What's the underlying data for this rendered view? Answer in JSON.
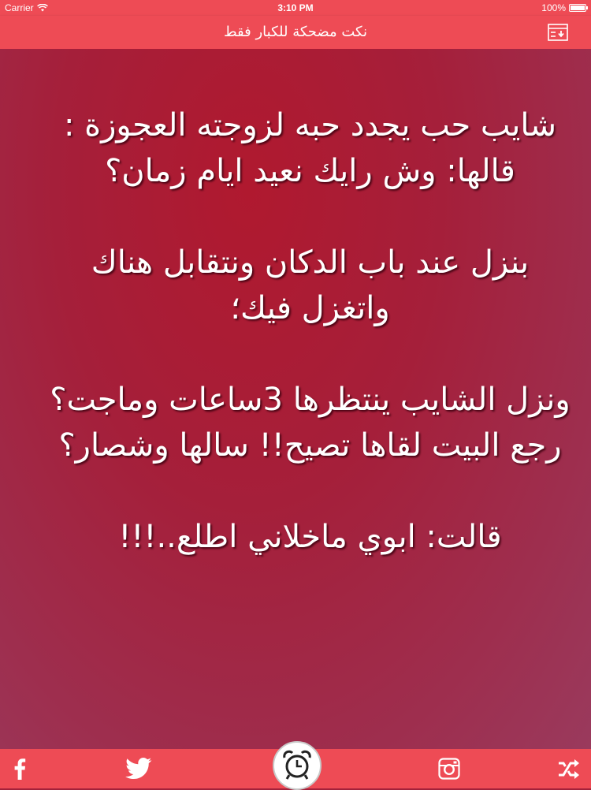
{
  "status_bar": {
    "carrier": "Carrier",
    "time": "3:10 PM",
    "battery": "100%",
    "battery_level": 1.0
  },
  "nav": {
    "title": "نكت مضحكة للكبار فقط",
    "menu_icon": "list-download-icon"
  },
  "joke": {
    "paragraphs": [
      "شايب حب يجدد حبه لزوجته العجوزة : قالها: وش رايك نعيد ايام زمان؟",
      "بنزل عند باب الدكان ونتقابل هناك واتغزل فيك؛",
      "ونزل الشايب ينتظرها 3ساعات وماجت؟رجع البيت لقاها تصيح!! سالها وشصار؟",
      "قالت: ابوي ماخلاني اطلع..!!!"
    ]
  },
  "tab_bar": {
    "icons": [
      "facebook-icon",
      "twitter-icon",
      "alarm-clock-icon",
      "instagram-icon",
      "shuffle-icon"
    ]
  },
  "colors": {
    "bar": "#ee4b55",
    "background": "#a3213a",
    "text": "#ffffff"
  }
}
